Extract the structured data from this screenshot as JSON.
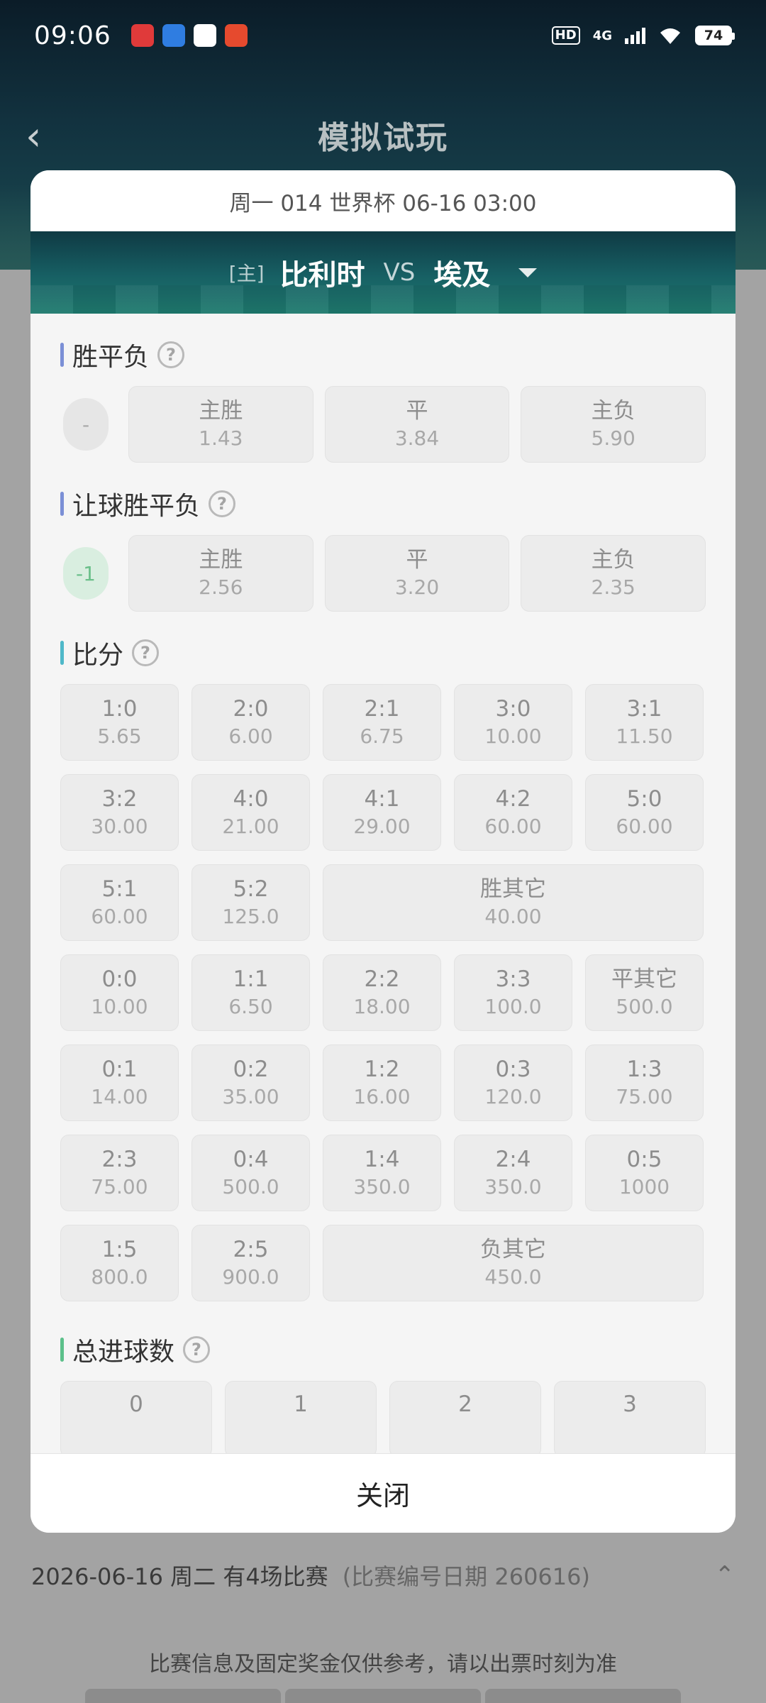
{
  "status_bar": {
    "time": "09:06",
    "app_icons": [
      {
        "name": "app-1",
        "color": "#e03a3a"
      },
      {
        "name": "app-2",
        "color": "#2f7de1"
      },
      {
        "name": "qq",
        "color": "#222222"
      },
      {
        "name": "app-4",
        "color": "#e64a2e"
      }
    ],
    "hd": "HD",
    "network": "4G",
    "battery": "74"
  },
  "background": {
    "title": "模拟试玩",
    "date_row": "2026-06-16 周二 有4场比赛",
    "date_note": "(比赛编号日期 260616)",
    "disclaimer": "比赛信息及固定奖金仅供参考，请以出票时刻为准"
  },
  "modal": {
    "match_info": "周一 014 世界杯 06-16 03:00",
    "host_tag": "[主]",
    "home_team": "比利时",
    "vs": "VS",
    "away_team": "埃及",
    "sections": {
      "wdl": {
        "title": "胜平负",
        "accent": "#7b8fd6",
        "handicap": "-",
        "options": [
          {
            "label": "主胜",
            "odds": "1.43"
          },
          {
            "label": "平",
            "odds": "3.84"
          },
          {
            "label": "主负",
            "odds": "5.90"
          }
        ]
      },
      "handicap_wdl": {
        "title": "让球胜平负",
        "accent": "#7b8fd6",
        "handicap": "-1",
        "options": [
          {
            "label": "主胜",
            "odds": "2.56"
          },
          {
            "label": "平",
            "odds": "3.20"
          },
          {
            "label": "主负",
            "odds": "2.35"
          }
        ]
      },
      "score": {
        "title": "比分",
        "accent": "#4fb8c9",
        "cells": [
          {
            "label": "1:0",
            "odds": "5.65"
          },
          {
            "label": "2:0",
            "odds": "6.00"
          },
          {
            "label": "2:1",
            "odds": "6.75"
          },
          {
            "label": "3:0",
            "odds": "10.00"
          },
          {
            "label": "3:1",
            "odds": "11.50"
          },
          {
            "label": "3:2",
            "odds": "30.00"
          },
          {
            "label": "4:0",
            "odds": "21.00"
          },
          {
            "label": "4:1",
            "odds": "29.00"
          },
          {
            "label": "4:2",
            "odds": "60.00"
          },
          {
            "label": "5:0",
            "odds": "60.00"
          },
          {
            "label": "5:1",
            "odds": "60.00"
          },
          {
            "label": "5:2",
            "odds": "125.0"
          },
          {
            "label": "胜其它",
            "odds": "40.00",
            "wide": true
          },
          {
            "label": "0:0",
            "odds": "10.00"
          },
          {
            "label": "1:1",
            "odds": "6.50"
          },
          {
            "label": "2:2",
            "odds": "18.00"
          },
          {
            "label": "3:3",
            "odds": "100.0"
          },
          {
            "label": "平其它",
            "odds": "500.0"
          },
          {
            "label": "0:1",
            "odds": "14.00"
          },
          {
            "label": "0:2",
            "odds": "35.00"
          },
          {
            "label": "1:2",
            "odds": "16.00"
          },
          {
            "label": "0:3",
            "odds": "120.0"
          },
          {
            "label": "1:3",
            "odds": "75.00"
          },
          {
            "label": "2:3",
            "odds": "75.00"
          },
          {
            "label": "0:4",
            "odds": "500.0"
          },
          {
            "label": "1:4",
            "odds": "350.0"
          },
          {
            "label": "2:4",
            "odds": "350.0"
          },
          {
            "label": "0:5",
            "odds": "1000"
          },
          {
            "label": "1:5",
            "odds": "800.0"
          },
          {
            "label": "2:5",
            "odds": "900.0"
          },
          {
            "label": "负其它",
            "odds": "450.0",
            "wide": true
          }
        ]
      },
      "total_goals": {
        "title": "总进球数",
        "accent": "#5cc08a",
        "options": [
          "0",
          "1",
          "2",
          "3"
        ]
      }
    },
    "help_symbol": "?",
    "close_label": "关闭"
  }
}
